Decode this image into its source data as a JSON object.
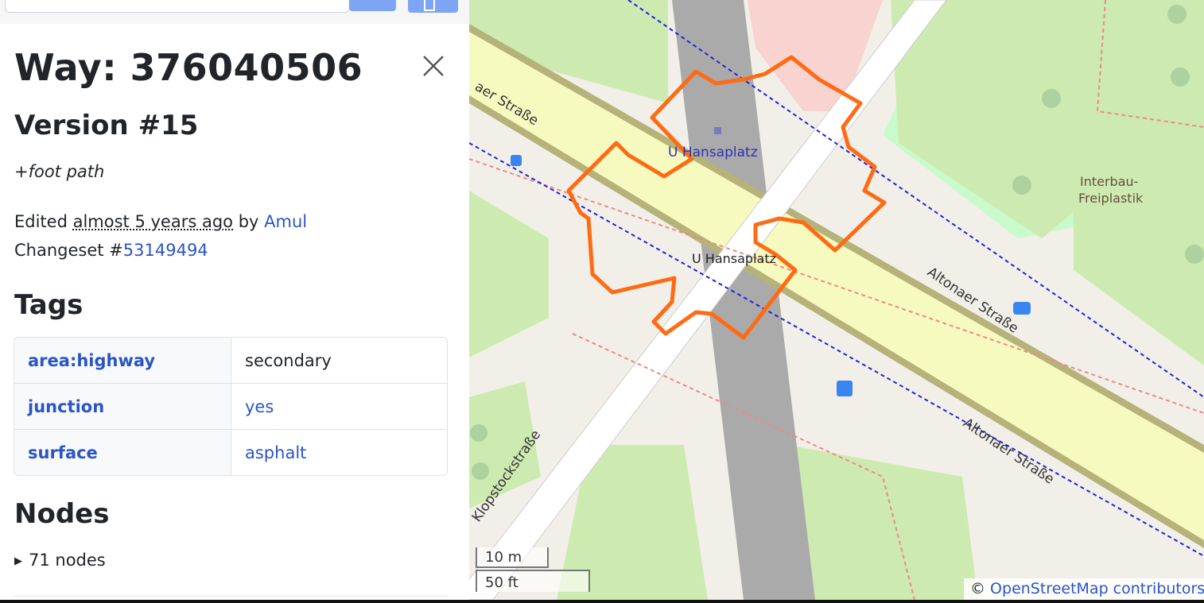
{
  "header": {
    "title": "Way: 376040506",
    "version": "Version #15"
  },
  "comment": "+foot path",
  "edit": {
    "prefix": "Edited ",
    "time": "almost 5 years ago",
    "by": " by ",
    "user": "Amul",
    "changeset_prefix": "Changeset #",
    "changeset": "53149494"
  },
  "tags": {
    "heading": "Tags",
    "rows": [
      {
        "key": "area:highway",
        "value": "secondary",
        "value_is_link": false
      },
      {
        "key": "junction",
        "value": "yes",
        "value_is_link": true
      },
      {
        "key": "surface",
        "value": "asphalt",
        "value_is_link": true
      }
    ]
  },
  "nodes": {
    "heading": "Nodes",
    "summary": "71 nodes"
  },
  "map": {
    "labels": {
      "station_top": "U Hansaplatz",
      "station_mid": "U Hansaplatz",
      "street_top_left": "aer Straße",
      "street_right_1": "Altonaer Straße",
      "street_right_2": "Altonaer Straße",
      "street_bottom_left": "Klopstockstraße",
      "poi_line1": "Interbau-",
      "poi_line2": "Freiplastik"
    },
    "scale_metric": "10 m",
    "scale_imperial": "50 ft",
    "attribution_prefix": "© ",
    "attribution_link": "OpenStreetMap contributors",
    "attribution_suffix": " ♥",
    "highlight_color": "#ff6a13"
  }
}
